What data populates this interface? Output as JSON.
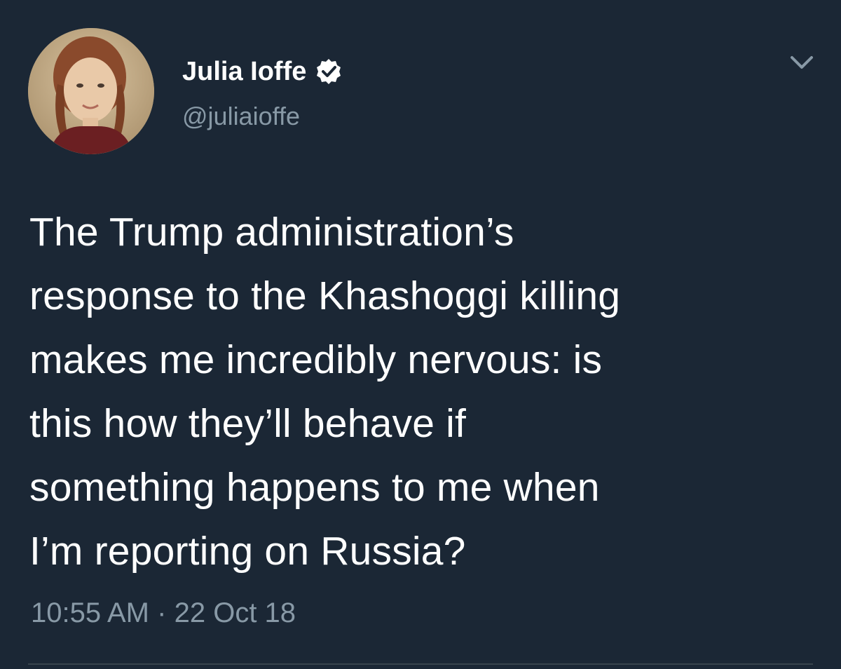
{
  "author": {
    "name": "Julia Ioffe",
    "handle": "@juliaioffe",
    "verified_icon": "verified-badge-icon",
    "avatar_icon": "avatar-photo"
  },
  "menu": {
    "icon": "chevron-down-icon"
  },
  "tweet": {
    "lines": [
      "The Trump administration’s",
      "response to the Khashoggi killing",
      "makes me incredibly nervous: is",
      "this how they’ll behave if",
      "something happens to me when",
      "I’m reporting on Russia?"
    ],
    "time": "10:55 AM",
    "separator": "·",
    "date": "22 Oct 18"
  },
  "colors": {
    "background": "#1b2735",
    "text": "#ffffff",
    "secondary": "#8899a6",
    "divider": "#38444d"
  }
}
